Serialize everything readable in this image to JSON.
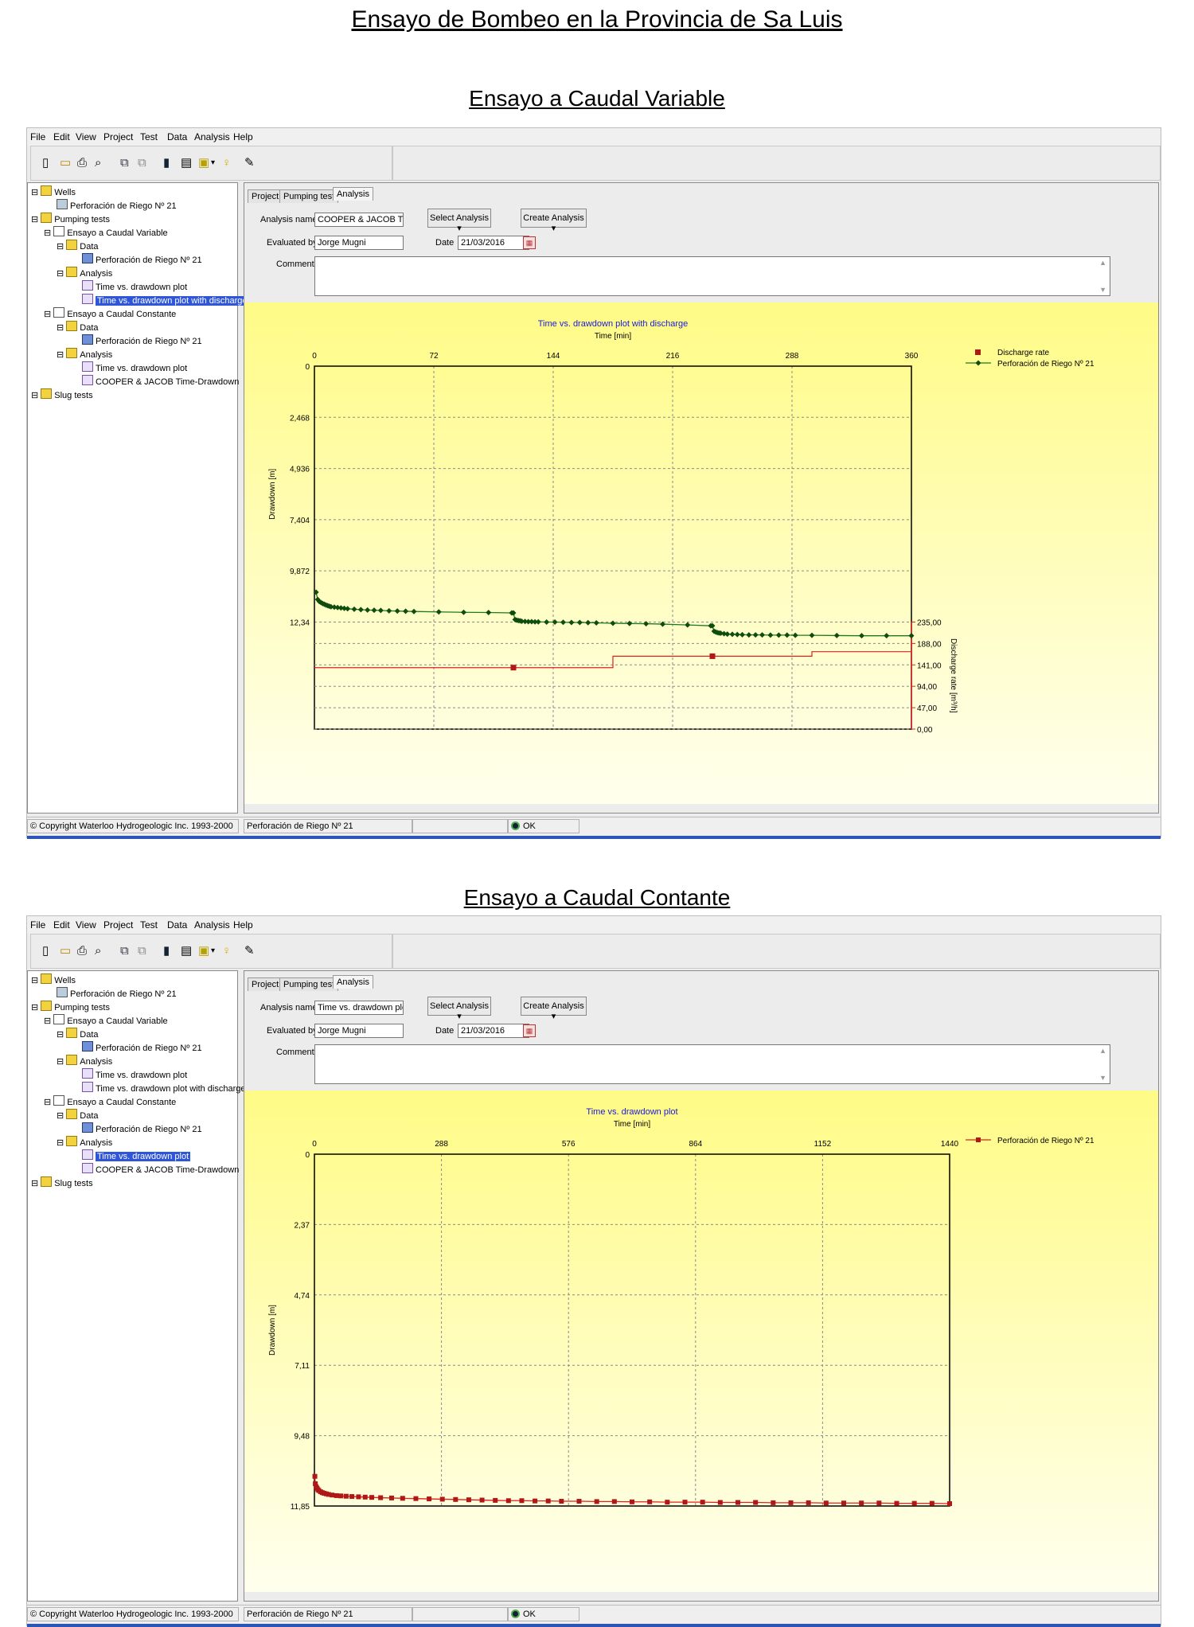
{
  "doc_title": "Ensayo de Bombeo en la Provincia de Sa Luis",
  "menu": [
    "File",
    "Edit",
    "View",
    "Project",
    "Test",
    "Data",
    "Analysis",
    "Help"
  ],
  "tree_labels": {
    "wells": "Wells",
    "well_1": "Perforación de Riego Nº 21",
    "pumping_tests": "Pumping tests",
    "test_variable": "Ensayo a Caudal Variable",
    "data": "Data",
    "data_well": "Perforación de Riego Nº 21",
    "analysis": "Analysis",
    "plot_time_drawdown": "Time vs. drawdown plot",
    "plot_with_discharge": "Time vs. drawdown plot with discharge",
    "test_constant": "Ensayo a Caudal Constante",
    "cooper_jacob": "COOPER & JACOB Time-Drawdown",
    "slug_tests": "Slug tests"
  },
  "tabs": [
    "Project",
    "Pumping test",
    "Analysis"
  ],
  "labels": {
    "analysis_name": "Analysis name",
    "evaluated_by": "Evaluated by",
    "date": "Date",
    "comment": "Comment",
    "select_analysis": "Select Analysis ▾",
    "create_analysis": "Create Analysis ▾"
  },
  "status": {
    "copyright": "© Copyright Waterloo Hydrogeologic Inc. 1993-2000",
    "well": "Perforación de Riego Nº 21",
    "ok": "OK"
  },
  "colors": {
    "drawdown_line": "#1f7a1f",
    "drawdown_marker": "#0e4d0e",
    "discharge_line": "#e02020",
    "marker_red": "#b01818",
    "chart_title": "#1a1ad0"
  },
  "windows": [
    {
      "section_title": "Ensayo a Caudal Variable",
      "analysis_name": "COOPER & JACOB Time-D",
      "evaluated_by": "Jorge Mugni",
      "date": "21/03/2016",
      "selected_tree_item": "plot_with_discharge"
    },
    {
      "section_title": "Ensayo a Caudal Contante",
      "analysis_name": "Time vs. drawdown plot",
      "evaluated_by": "Jorge Mugni",
      "date": "21/03/2016",
      "selected_tree_item": "plot_time_drawdown_constant"
    }
  ],
  "chart_data": [
    {
      "type": "line",
      "title": "Time vs. drawdown plot with discharge",
      "xlabel": "Time [min]",
      "ylabel": "Drawdown [m]",
      "y2label": "Discharge rate [m³/h]",
      "x_ticks": [
        "0",
        "72",
        "144",
        "216",
        "288",
        "360"
      ],
      "y_ticks": [
        "0",
        "2,468",
        "4,936",
        "7,404",
        "9,872",
        "12,34"
      ],
      "y2_ticks": [
        "235,00",
        "188,00",
        "141,00",
        "94,00",
        "47,00",
        "0,00"
      ],
      "xlim": [
        0,
        360
      ],
      "ylim": [
        0,
        12.34
      ],
      "y2lim": [
        0,
        235
      ],
      "y_inverted": true,
      "grid": true,
      "legend": "top-right",
      "series": [
        {
          "name": "Discharge rate",
          "kind": "step",
          "x": [
            0,
            180,
            180,
            300,
            300,
            360
          ],
          "y": [
            135,
            135,
            160,
            160,
            170,
            170
          ],
          "markers_x": [
            120,
            240
          ],
          "markers_y": [
            135,
            160
          ]
        },
        {
          "name": "Perforación de Riego Nº 21",
          "kind": "line",
          "x": [
            1,
            2,
            3,
            4,
            5,
            6,
            7,
            8,
            9,
            10,
            12,
            14,
            16,
            18,
            20,
            24,
            28,
            32,
            36,
            40,
            45,
            50,
            55,
            60,
            75,
            90,
            105,
            119,
            120,
            121,
            122,
            123,
            124,
            125,
            127,
            129,
            131,
            133,
            135,
            140,
            145,
            150,
            155,
            160,
            165,
            170,
            180,
            190,
            200,
            210,
            225,
            239,
            240,
            241,
            242,
            243,
            244,
            245,
            247,
            249,
            252,
            255,
            258,
            262,
            266,
            270,
            275,
            280,
            285,
            290,
            300,
            315,
            330,
            345,
            360
          ],
          "y": [
            10.9,
            11.25,
            11.35,
            11.4,
            11.45,
            11.48,
            11.52,
            11.55,
            11.58,
            11.6,
            11.62,
            11.64,
            11.66,
            11.68,
            11.7,
            11.72,
            11.74,
            11.76,
            11.77,
            11.78,
            11.8,
            11.81,
            11.82,
            11.83,
            11.85,
            11.87,
            11.88,
            11.9,
            11.9,
            12.22,
            12.25,
            12.27,
            12.28,
            12.3,
            12.31,
            12.32,
            12.32,
            12.33,
            12.33,
            12.34,
            12.34,
            12.35,
            12.36,
            12.36,
            12.37,
            12.38,
            12.4,
            12.41,
            12.42,
            12.44,
            12.48,
            12.52,
            12.52,
            12.78,
            12.82,
            12.85,
            12.87,
            12.88,
            12.9,
            12.92,
            12.93,
            12.94,
            12.95,
            12.96,
            12.96,
            12.96,
            12.97,
            12.97,
            12.97,
            12.98,
            12.98,
            12.99,
            13.0,
            13.0,
            13.0
          ]
        }
      ]
    },
    {
      "type": "line",
      "title": "Time vs. drawdown plot",
      "xlabel": "Time [min]",
      "ylabel": "Drawdown [m]",
      "x_ticks": [
        "0",
        "288",
        "576",
        "864",
        "1152",
        "1440"
      ],
      "y_ticks": [
        "0",
        "2,37",
        "4,74",
        "7,11",
        "9,48",
        "11,85"
      ],
      "xlim": [
        0,
        1440
      ],
      "ylim": [
        0,
        11.85
      ],
      "y_inverted": true,
      "grid": true,
      "legend": "top-right",
      "series": [
        {
          "name": "Perforación de Riego Nº 21",
          "kind": "line",
          "x": [
            1,
            2,
            4,
            6,
            8,
            10,
            14,
            18,
            22,
            27,
            32,
            40,
            50,
            60,
            72,
            85,
            100,
            115,
            130,
            150,
            175,
            200,
            230,
            260,
            290,
            320,
            350,
            380,
            410,
            440,
            470,
            500,
            530,
            560,
            600,
            640,
            680,
            720,
            760,
            800,
            840,
            880,
            920,
            960,
            1000,
            1040,
            1080,
            1120,
            1160,
            1200,
            1240,
            1280,
            1320,
            1360,
            1400,
            1440
          ],
          "y": [
            10.85,
            11.1,
            11.2,
            11.25,
            11.3,
            11.33,
            11.37,
            11.4,
            11.42,
            11.44,
            11.46,
            11.48,
            11.5,
            11.51,
            11.52,
            11.53,
            11.54,
            11.55,
            11.56,
            11.57,
            11.58,
            11.59,
            11.6,
            11.61,
            11.62,
            11.63,
            11.64,
            11.65,
            11.66,
            11.67,
            11.67,
            11.68,
            11.68,
            11.69,
            11.69,
            11.7,
            11.7,
            11.71,
            11.71,
            11.72,
            11.72,
            11.72,
            11.73,
            11.73,
            11.73,
            11.74,
            11.74,
            11.74,
            11.75,
            11.75,
            11.75,
            11.75,
            11.76,
            11.76,
            11.76,
            11.77
          ]
        }
      ]
    }
  ]
}
